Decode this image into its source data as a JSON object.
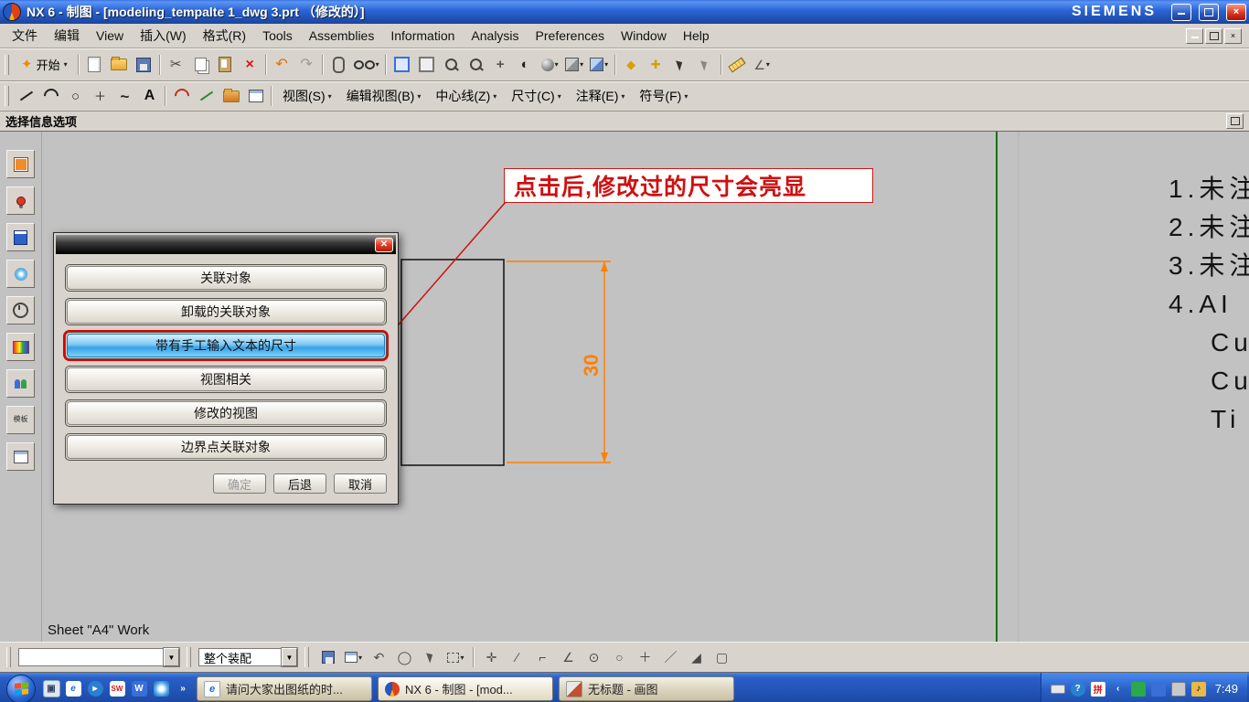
{
  "titlebar": {
    "title": "NX 6 - 制图 - [modeling_tempalte 1_dwg 3.prt （修改的）]",
    "brand": "SIEMENS"
  },
  "menubar": {
    "items": [
      {
        "label": "文件"
      },
      {
        "label": "编辑"
      },
      {
        "label": "View"
      },
      {
        "label": "插入(W)"
      },
      {
        "label": "格式(R)"
      },
      {
        "label": "Tools"
      },
      {
        "label": "Assemblies"
      },
      {
        "label": "Information"
      },
      {
        "label": "Analysis"
      },
      {
        "label": "Preferences"
      },
      {
        "label": "Window"
      },
      {
        "label": "Help"
      }
    ]
  },
  "toolbar1": {
    "start_label": "开始"
  },
  "toolbar2": {
    "dropdowns": [
      {
        "label": "视图(S)"
      },
      {
        "label": "编辑视图(B)"
      },
      {
        "label": "中心线(Z)"
      },
      {
        "label": "尺寸(C)"
      },
      {
        "label": "注释(E)"
      },
      {
        "label": "符号(F)"
      }
    ],
    "text_tool_label": "A"
  },
  "infobar": {
    "label": "选择信息选项"
  },
  "canvas": {
    "annotation": "点击后,修改过的尺寸会亮显",
    "dimension": "30",
    "notes": [
      {
        "text": "1.未注"
      },
      {
        "text": "2.未注"
      },
      {
        "text": "3.未注"
      },
      {
        "text": "4.AI"
      },
      {
        "text": "Cu"
      },
      {
        "text": "Cu"
      },
      {
        "text": "Ti"
      }
    ],
    "sheet_status": "Sheet \"A4\" Work"
  },
  "dialog": {
    "items": [
      {
        "label": "关联对象"
      },
      {
        "label": "卸载的关联对象"
      },
      {
        "label": "带有手工输入文本的尺寸",
        "highlighted": true
      },
      {
        "label": "视图相关"
      },
      {
        "label": "修改的视图"
      },
      {
        "label": "边界点关联对象"
      }
    ],
    "ok": "确定",
    "back": "后退",
    "cancel": "取消"
  },
  "bottombar": {
    "filter_value": "",
    "assembly_scope": "整个装配"
  },
  "taskbar": {
    "windows": [
      {
        "label": "请问大家出图纸的时..."
      },
      {
        "label": "NX 6 - 制图 - [mod...",
        "active": true
      },
      {
        "label": "无标题 - 画图"
      }
    ],
    "clock": "7:49"
  },
  "colors": {
    "highlight_blue": "#35a3ea",
    "dimension_orange": "#ff8000",
    "annotation_red": "#cf1010",
    "sheet_border_green": "#0b720b"
  }
}
